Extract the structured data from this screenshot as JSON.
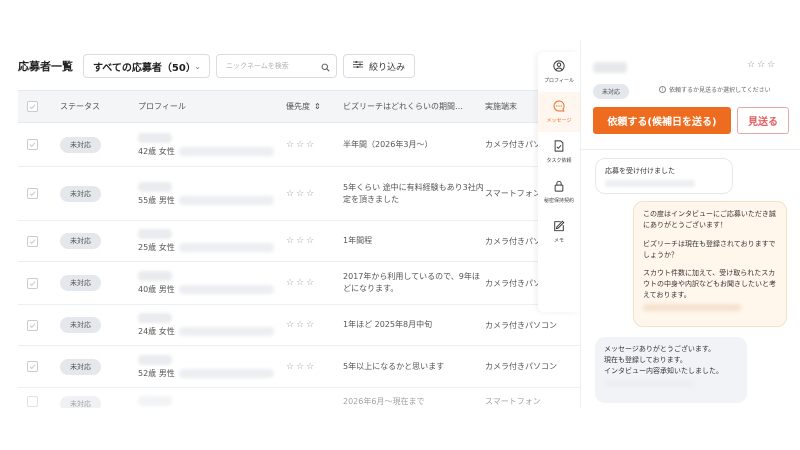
{
  "header": {
    "title": "応募者一覧",
    "filter_select": "すべての応募者（50）",
    "search_placeholder": "ニックネームを検索",
    "filter_button": "絞り込み"
  },
  "table": {
    "columns": {
      "status": "ステータス",
      "profile": "プロフィール",
      "priority": "優先度",
      "period": "ビズリーチはどれくらいの期間…",
      "device": "実施端末"
    },
    "rows": [
      {
        "status": "未対応",
        "profile": "42歳 女性",
        "priority": "☆☆☆",
        "period": "半年間（2026年3月〜）",
        "device": "カメラ付きパソ"
      },
      {
        "status": "未対応",
        "profile": "55歳 男性",
        "priority": "☆☆☆",
        "period": "5年くらい 途中に有料経験もあり3社内定を頂きました",
        "device": "スマートフォン"
      },
      {
        "status": "未対応",
        "profile": "25歳 女性",
        "priority": "☆☆☆",
        "period": "1年間程",
        "device": "カメラ付きパソ"
      },
      {
        "status": "未対応",
        "profile": "40歳 男性",
        "priority": "☆☆☆",
        "period": "2017年から利用しているので、9年ほどになります。",
        "device": "カメラ付きパソコン"
      },
      {
        "status": "未対応",
        "profile": "24歳 女性",
        "priority": "☆☆☆",
        "period": "1年ほど 2025年8月中旬",
        "device": "カメラ付きパソコン"
      },
      {
        "status": "未対応",
        "profile": "52歳 男性",
        "priority": "☆☆☆",
        "period": "5年以上になるかと思います",
        "device": "カメラ付きパソコン"
      },
      {
        "status": "未対応",
        "profile": "",
        "priority": "",
        "period": "2026年6月〜現在まで",
        "device": "スマートフォン"
      }
    ]
  },
  "side_menu": {
    "items": [
      {
        "label": "プロフィール",
        "icon": "profile-icon"
      },
      {
        "label": "メッセージ",
        "icon": "message-icon",
        "active": true
      },
      {
        "label": "タスク依頼",
        "icon": "task-icon"
      },
      {
        "label": "秘密保持契約",
        "icon": "lock-icon"
      },
      {
        "label": "メモ",
        "icon": "memo-icon"
      }
    ]
  },
  "chat": {
    "stars": "☆☆☆",
    "status_badge": "未対応",
    "hint": "依頼するか見送るか選択してください",
    "primary_button": "依頼する(候補日を送る)",
    "secondary_button": "見送る",
    "messages": [
      {
        "direction": "incoming",
        "lines": [
          "応募を受け付けました"
        ]
      },
      {
        "direction": "outgoing",
        "lines": [
          "この度はインタビューにご応募いただき誠にありがとうございます！",
          "",
          "ビズリーチは現在も登録されておりますでしょうか？",
          "",
          "スカウト件数に加えて、受け取られたスカウトの中身や内訳などもお聞きしたいと考えております。"
        ]
      },
      {
        "direction": "incoming",
        "lines": [
          "メッセージありがとうございます。",
          "現在も登録しております。",
          "インタビュー内容承知いたしました。"
        ]
      }
    ]
  },
  "colors": {
    "accent": "#ee6c1f",
    "secondary_border": "#e8a8a8",
    "badge_bg": "#e4e7ec",
    "outgoing_bubble": "#fff6ec"
  }
}
